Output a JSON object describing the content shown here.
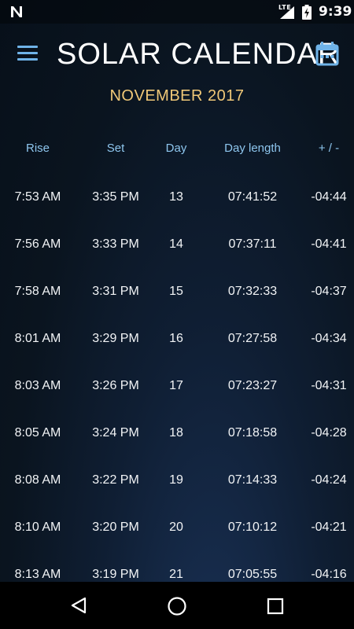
{
  "status_bar": {
    "notification_icon": "n-notification-icon",
    "network_label": "LTE",
    "time": "9:39"
  },
  "header": {
    "title": "SOLAR CALENDAR",
    "menu_icon": "hamburger-menu-icon",
    "calendar_icon": "calendar-icon",
    "month": "NOVEMBER 2017"
  },
  "table": {
    "columns": [
      "Rise",
      "Set",
      "Day",
      "Day length",
      "+ / -"
    ],
    "rows": [
      {
        "rise": "7:53 AM",
        "set": "3:35 PM",
        "day": "13",
        "length": "07:41:52",
        "diff": "-04:44"
      },
      {
        "rise": "7:56 AM",
        "set": "3:33 PM",
        "day": "14",
        "length": "07:37:11",
        "diff": "-04:41"
      },
      {
        "rise": "7:58 AM",
        "set": "3:31 PM",
        "day": "15",
        "length": "07:32:33",
        "diff": "-04:37"
      },
      {
        "rise": "8:01 AM",
        "set": "3:29 PM",
        "day": "16",
        "length": "07:27:58",
        "diff": "-04:34"
      },
      {
        "rise": "8:03 AM",
        "set": "3:26 PM",
        "day": "17",
        "length": "07:23:27",
        "diff": "-04:31"
      },
      {
        "rise": "8:05 AM",
        "set": "3:24 PM",
        "day": "18",
        "length": "07:18:58",
        "diff": "-04:28"
      },
      {
        "rise": "8:08 AM",
        "set": "3:22 PM",
        "day": "19",
        "length": "07:14:33",
        "diff": "-04:24"
      },
      {
        "rise": "8:10 AM",
        "set": "3:20 PM",
        "day": "20",
        "length": "07:10:12",
        "diff": "-04:21"
      },
      {
        "rise": "8:13 AM",
        "set": "3:19 PM",
        "day": "21",
        "length": "07:05:55",
        "diff": "-04:16"
      }
    ]
  },
  "nav_bar": {
    "back_icon": "back-triangle-icon",
    "home_icon": "home-circle-icon",
    "recents_icon": "recents-square-icon"
  },
  "colors": {
    "accent_blue": "#6fb3e8",
    "header_label": "#8ec6ee",
    "month_gold": "#f0c878",
    "text": "#f2f4f6",
    "background": "#0a141f"
  }
}
